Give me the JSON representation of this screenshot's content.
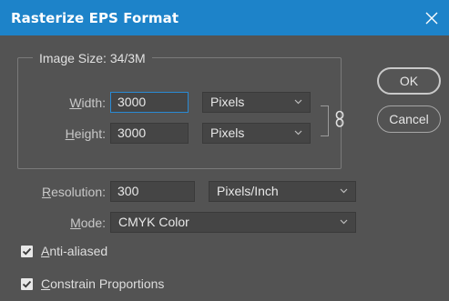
{
  "window": {
    "title": "Rasterize EPS Format"
  },
  "image_size": {
    "legend": "Image Size: 34/3M",
    "width_label_prefix": "",
    "width_label_mnemonic": "W",
    "width_label_rest": "idth:",
    "width_value": "3000",
    "width_unit": "Pixels",
    "height_label_mnemonic": "H",
    "height_label_rest": "eight:",
    "height_value": "3000",
    "height_unit": "Pixels"
  },
  "resolution": {
    "label_mnemonic": "R",
    "label_rest": "esolution:",
    "value": "300",
    "unit": "Pixels/Inch"
  },
  "mode": {
    "label_mnemonic": "M",
    "label_rest": "ode:",
    "value": "CMYK Color"
  },
  "options": [
    {
      "mnemonic": "A",
      "rest": "nti-aliased",
      "checked": true
    },
    {
      "mnemonic": "C",
      "rest": "onstrain Proportions",
      "checked": true
    }
  ],
  "buttons": {
    "ok": "OK",
    "cancel": "Cancel"
  },
  "colors": {
    "titlebar": "#1d83c9",
    "dialog_bg": "#535353",
    "field_bg": "#454545",
    "focus_border": "#2a8ad4"
  }
}
